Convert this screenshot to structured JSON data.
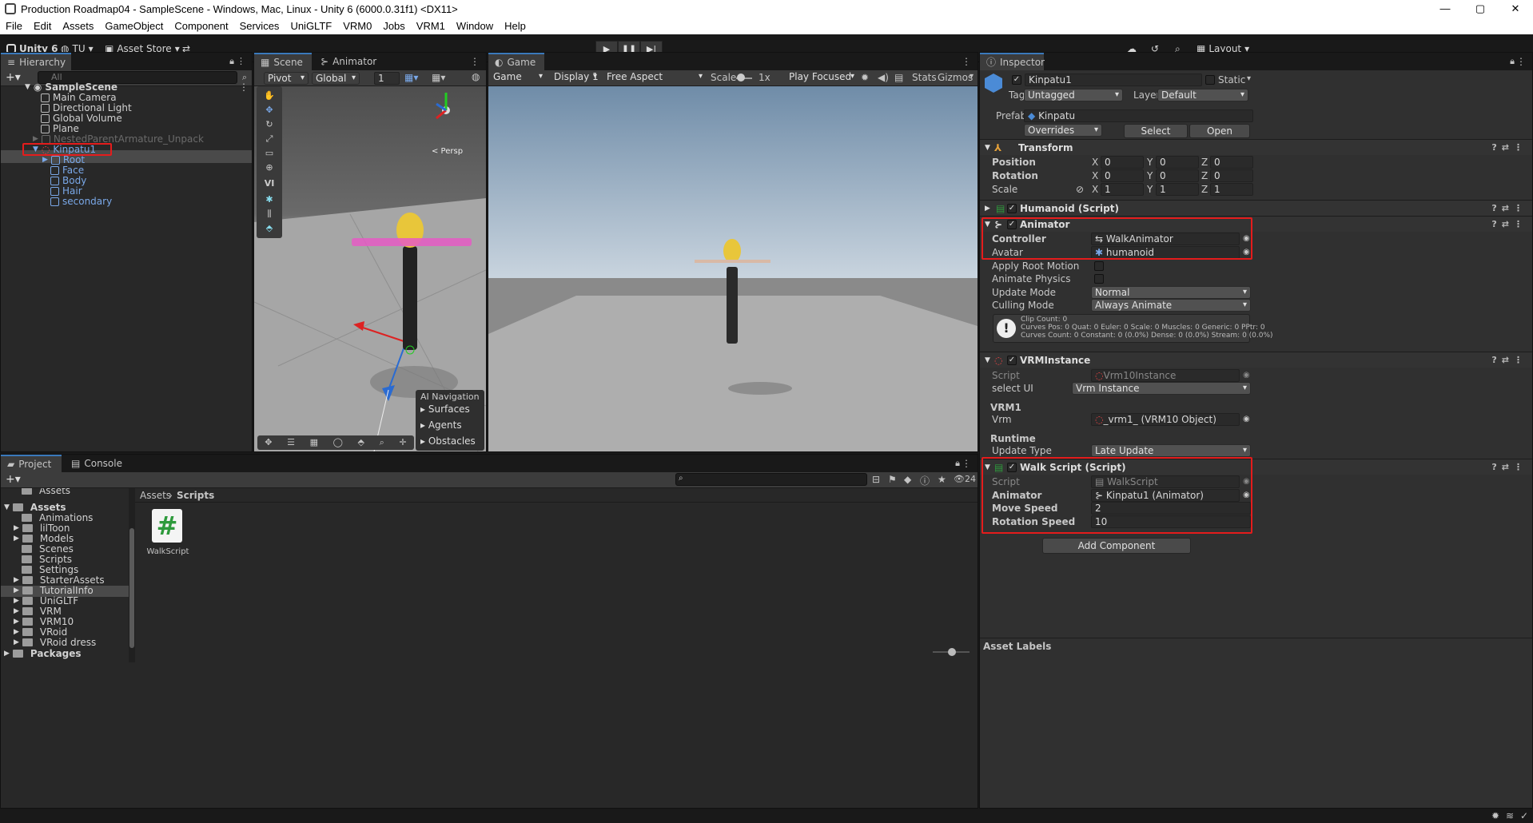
{
  "window": {
    "title": "Production Roadmap04 - SampleScene - Windows, Mac, Linux - Unity 6 (6000.0.31f1) <DX11>",
    "controls": [
      "—",
      "▢",
      "✕"
    ]
  },
  "menu": [
    "File",
    "Edit",
    "Assets",
    "GameObject",
    "Component",
    "Services",
    "UniGLTF",
    "VRM0",
    "Jobs",
    "VRM1",
    "Window",
    "Help"
  ],
  "toolbar": {
    "unity_label": "Unity 6",
    "account": "TU",
    "asset_store": "Asset Store",
    "layout": "Layout"
  },
  "hierarchy": {
    "tab": "Hierarchy",
    "search_placeholder": "All",
    "rows": [
      "SampleScene",
      "Main Camera",
      "Directional Light",
      "Global Volume",
      "Plane",
      "NestedParentArmature_Unpack",
      "Kinpatu1",
      "Root",
      "Face",
      "Body",
      "Hair",
      "secondary"
    ]
  },
  "scene": {
    "tab_scene": "Scene",
    "tab_animator": "Animator",
    "pivot": "Pivot",
    "global": "Global",
    "grid_value": "1",
    "persp": "< Persp",
    "vi_label": "VI",
    "ai_nav": {
      "title": "AI Navigation",
      "items": [
        "Surfaces",
        "Agents",
        "Obstacles"
      ]
    }
  },
  "game": {
    "tab": "Game",
    "mode": "Game",
    "display": "Display 1",
    "aspect": "Free Aspect",
    "scale_label": "Scale",
    "scale_value": "1x",
    "play_focused": "Play Focused",
    "stats": "Stats",
    "gizmos": "Gizmos"
  },
  "inspector": {
    "tab": "Inspector",
    "object_name": "Kinpatu1",
    "static_label": "Static",
    "tag_label": "Tag",
    "tag_value": "Untagged",
    "layer_label": "Layer",
    "layer_value": "Default",
    "prefab_label": "Prefab",
    "prefab_value": "Kinpatu",
    "overrides": "Overrides",
    "select": "Select",
    "open": "Open",
    "transform": {
      "title": "Transform",
      "position_label": "Position",
      "rotation_label": "Rotation",
      "scale_label": "Scale",
      "position": [
        "0",
        "0",
        "0"
      ],
      "rotation": [
        "0",
        "0",
        "0"
      ],
      "scale": [
        "1",
        "1",
        "1"
      ],
      "axes": [
        "X",
        "Y",
        "Z"
      ]
    },
    "humanoid": {
      "title": "Humanoid (Script)"
    },
    "animator": {
      "title": "Animator",
      "controller_label": "Controller",
      "controller_value": "WalkAnimator",
      "avatar_label": "Avatar",
      "avatar_value": "humanoid",
      "apply_root_label": "Apply Root Motion",
      "animate_physics_label": "Animate Physics",
      "update_mode_label": "Update Mode",
      "update_mode_value": "Normal",
      "culling_label": "Culling Mode",
      "culling_value": "Always Animate",
      "info_line1": "Clip Count: 0",
      "info_line2": "Curves Pos: 0 Quat: 0 Euler: 0 Scale: 0 Muscles: 0 Generic: 0 PPtr: 0",
      "info_line3": "Curves Count: 0 Constant: 0 (0.0%) Dense: 0 (0.0%) Stream: 0 (0.0%)"
    },
    "vrm_instance": {
      "title": "VRMInstance",
      "script_label": "Script",
      "script_value": "Vrm10Instance",
      "select_ui_label": "select UI",
      "select_ui_value": "Vrm Instance",
      "vrm1_section": "VRM1",
      "vrm_label": "Vrm",
      "vrm_value": "_vrm1_ (VRM10 Object)",
      "runtime_section": "Runtime",
      "update_type_label": "Update Type",
      "update_type_value": "Late Update"
    },
    "walk_script": {
      "title": "Walk Script (Script)",
      "script_label": "Script",
      "script_value": "WalkScript",
      "animator_label": "Animator",
      "animator_value": "Kinpatu1 (Animator)",
      "move_speed_label": "Move Speed",
      "move_speed_value": "2",
      "rotation_speed_label": "Rotation Speed",
      "rotation_speed_value": "10"
    },
    "add_component": "Add Component",
    "asset_labels": "Asset Labels"
  },
  "project": {
    "tab_project": "Project",
    "tab_console": "Console",
    "count": "24",
    "top_partial": "Assets",
    "tree_root": "Assets",
    "folders": [
      "Animations",
      "lilToon",
      "Models",
      "Scenes",
      "Scripts",
      "Settings",
      "StarterAssets",
      "TutorialInfo",
      "UniGLTF",
      "VRM",
      "VRM10",
      "VRoid",
      "VRoid dress"
    ],
    "packages": "Packages",
    "breadcrumb": [
      "Assets",
      "Scripts"
    ],
    "file_name": "WalkScript",
    "file_glyph": "#"
  },
  "colors": {
    "accent": "#3a79bb",
    "highlight_box": "#e41c1c",
    "prefab_blue": "#7aa8e8",
    "script_green": "#2e9a3c"
  }
}
